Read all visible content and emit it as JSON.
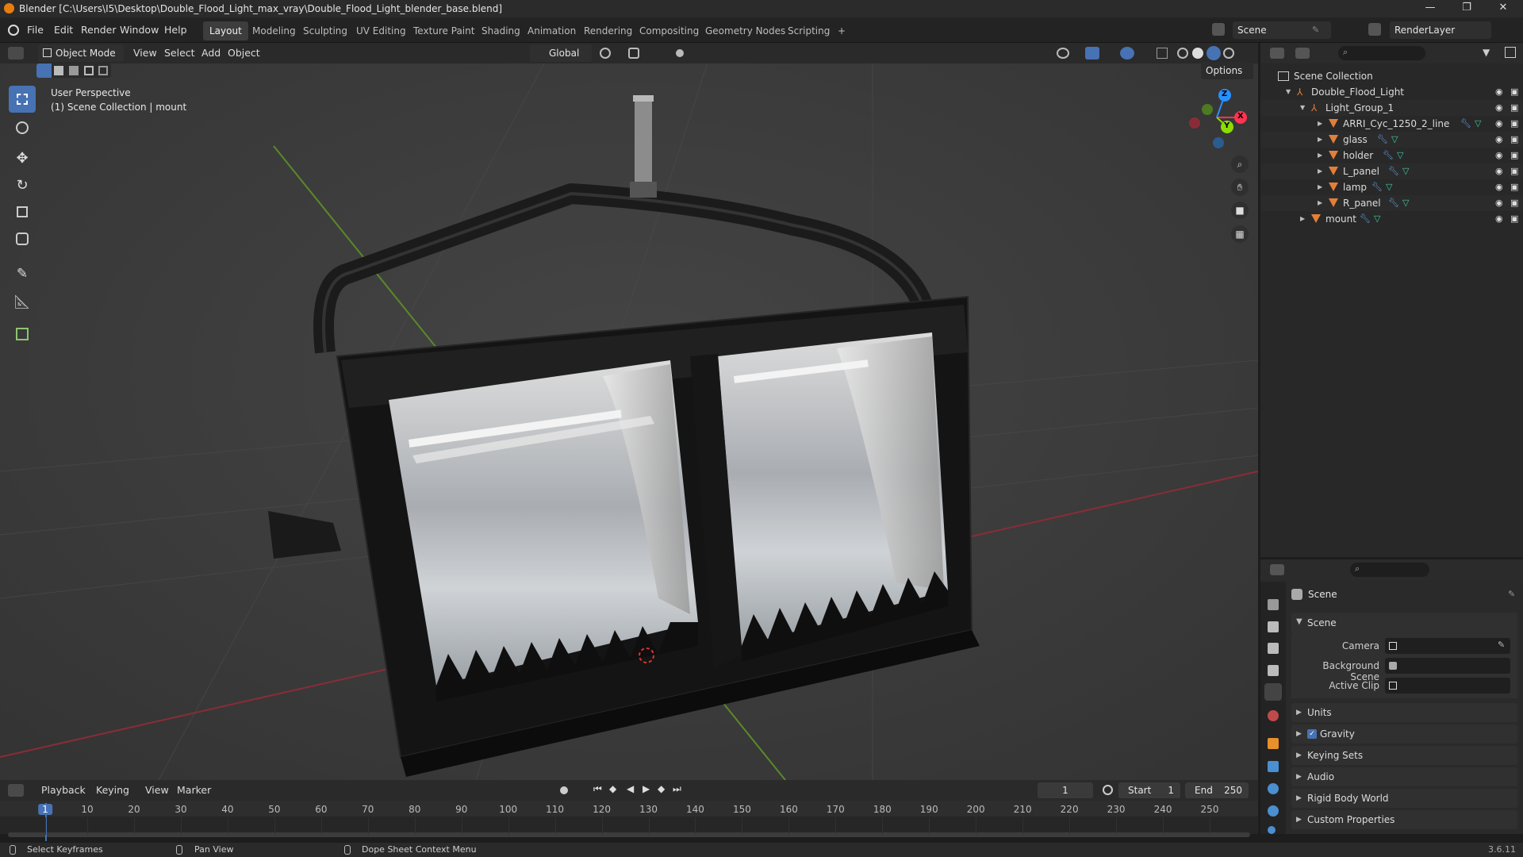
{
  "window": {
    "title": "Blender [C:\\Users\\I5\\Desktop\\Double_Flood_Light_max_vray\\Double_Flood_Light_blender_base.blend]",
    "controls": [
      "—",
      "❐",
      "✕"
    ]
  },
  "menu": [
    "File",
    "Edit",
    "Render",
    "Window",
    "Help"
  ],
  "workspaces": [
    {
      "label": "Layout",
      "active": true
    },
    {
      "label": "Modeling"
    },
    {
      "label": "Sculpting"
    },
    {
      "label": "UV Editing"
    },
    {
      "label": "Texture Paint"
    },
    {
      "label": "Shading"
    },
    {
      "label": "Animation"
    },
    {
      "label": "Rendering"
    },
    {
      "label": "Compositing"
    },
    {
      "label": "Geometry Nodes"
    },
    {
      "label": "Scripting"
    },
    {
      "label": "+"
    }
  ],
  "scene_selector": {
    "scene": "Scene",
    "view_layer": "RenderLayer"
  },
  "viewport_header": {
    "mode": "Object Mode",
    "menus": [
      "View",
      "Select",
      "Add",
      "Object"
    ],
    "orientation": "Global",
    "options": "Options"
  },
  "viewport": {
    "perspective": "User Perspective",
    "context": "(1) Scene Collection | mount",
    "gizmo": {
      "x": "X",
      "y": "Y",
      "z": "Z"
    }
  },
  "tools": [
    "select-box",
    "cursor",
    "move",
    "rotate",
    "scale",
    "transform",
    "annotate",
    "measure",
    "add-cube"
  ],
  "outliner": {
    "root": "Scene Collection",
    "items": [
      {
        "label": "Double_Flood_Light",
        "level": 1,
        "type": "empty"
      },
      {
        "label": "Light_Group_1",
        "level": 2,
        "type": "empty"
      },
      {
        "label": "ARRI_Cyc_1250_2_line",
        "level": 3,
        "type": "mesh"
      },
      {
        "label": "glass",
        "level": 3,
        "type": "mesh"
      },
      {
        "label": "holder",
        "level": 3,
        "type": "mesh"
      },
      {
        "label": "L_panel",
        "level": 3,
        "type": "mesh"
      },
      {
        "label": "lamp",
        "level": 3,
        "type": "mesh"
      },
      {
        "label": "R_panel",
        "level": 3,
        "type": "mesh"
      },
      {
        "label": "mount",
        "level": 2,
        "type": "mesh"
      }
    ]
  },
  "properties": {
    "title": "Scene",
    "section": "Scene",
    "fields": [
      {
        "label": "Camera"
      },
      {
        "label": "Background Scene"
      },
      {
        "label": "Active Clip"
      }
    ],
    "panels": [
      {
        "label": "Units"
      },
      {
        "label": "Gravity",
        "checked": true
      },
      {
        "label": "Keying Sets"
      },
      {
        "label": "Audio"
      },
      {
        "label": "Rigid Body World"
      },
      {
        "label": "Custom Properties"
      }
    ]
  },
  "timeline": {
    "menus": [
      "Playback",
      "Keying",
      "View",
      "Marker"
    ],
    "current_frame": "1",
    "start_label": "Start",
    "start": "1",
    "end_label": "End",
    "end": "250",
    "ticks": [
      "1",
      "10",
      "20",
      "30",
      "40",
      "50",
      "60",
      "70",
      "80",
      "90",
      "100",
      "110",
      "120",
      "130",
      "140",
      "150",
      "160",
      "170",
      "180",
      "190",
      "200",
      "210",
      "220",
      "230",
      "240",
      "250"
    ]
  },
  "status": {
    "hints": [
      "Select Keyframes",
      "Pan View",
      "Dope Sheet Context Menu"
    ],
    "version": "3.6.11"
  },
  "colors": {
    "accent": "#4772b3",
    "mesh_icon": "#e27f3a",
    "axis_x": "#ff3352",
    "axis_y": "#8bdc00",
    "axis_z": "#2890ff"
  }
}
